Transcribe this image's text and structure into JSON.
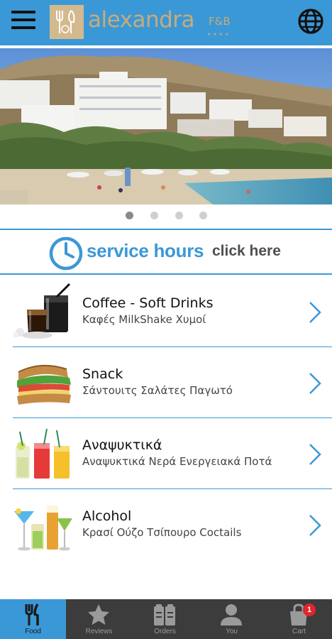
{
  "header": {
    "logo_text": "alexandra",
    "logo_sub": "F&B",
    "logo_stars": "★★★★",
    "menu_icon": "hamburger-menu-icon",
    "language_icon": "globe-icon"
  },
  "carousel": {
    "slide_count": 4,
    "active_index": 0
  },
  "service_hours": {
    "title": "service hours",
    "link": "click here",
    "icon": "clock-icon"
  },
  "menu": [
    {
      "title": "Coffee - Soft Drinks",
      "subtitle": "Καφές MilkShake Χυμοί",
      "icon": "coffee-drinks-image"
    },
    {
      "title": "Snack",
      "subtitle": "Σάντουιτς Σαλάτες Παγωτό",
      "icon": "sandwich-image"
    },
    {
      "title": "Αναψυκτικά",
      "subtitle": "Αναψυκτικά Νερά Ενεργειακά Ποτά",
      "icon": "soft-drinks-image"
    },
    {
      "title": "Alcohol",
      "subtitle": "Κρασί Ούζο Τσίπουρο Coctails",
      "icon": "cocktails-image"
    }
  ],
  "bottom_nav": [
    {
      "label": "Food",
      "icon": "cutlery-icon",
      "active": true
    },
    {
      "label": "Reviews",
      "icon": "star-icon",
      "active": false
    },
    {
      "label": "Orders",
      "icon": "clipboard-icon",
      "active": false
    },
    {
      "label": "You",
      "icon": "user-icon",
      "active": false
    },
    {
      "label": "Cart",
      "icon": "shopping-bag-icon",
      "active": false,
      "badge": "1"
    }
  ],
  "colors": {
    "accent": "#3b98d6",
    "logo": "#c7ab7c",
    "nav_background": "#3c3c3c",
    "badge": "#e0242b"
  }
}
